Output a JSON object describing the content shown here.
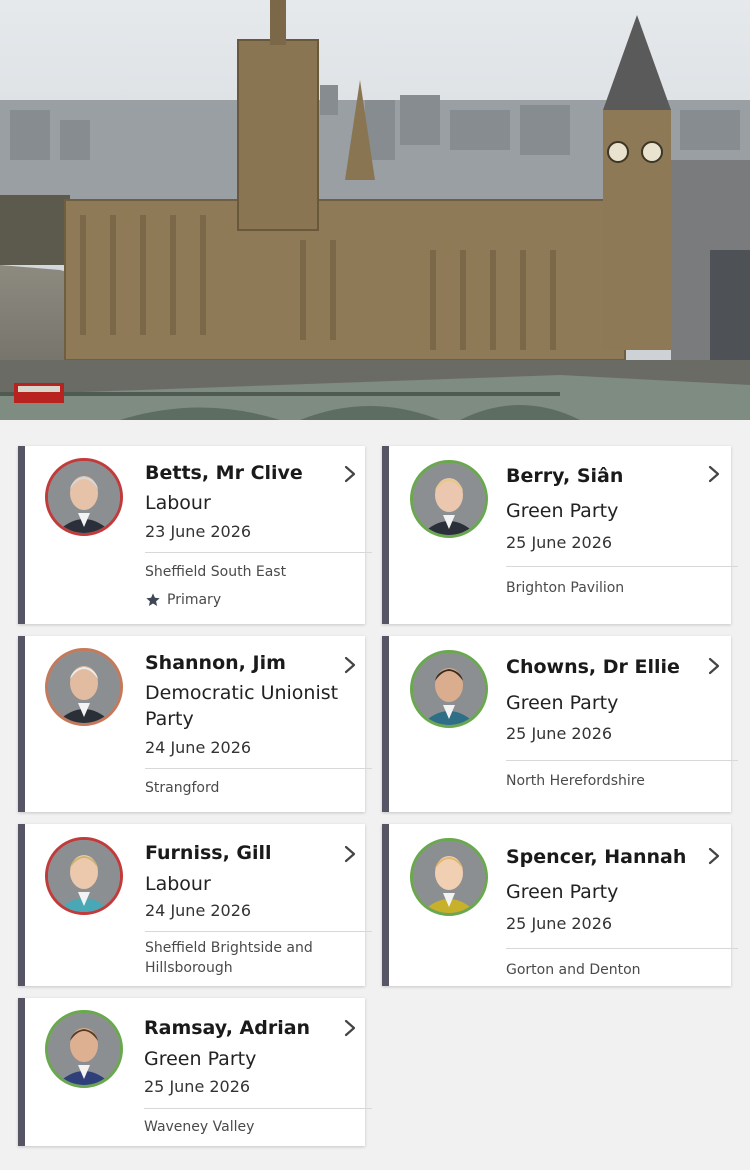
{
  "colors": {
    "card_bar": "#555566",
    "labour_ring": "#c23b3b",
    "dup_ring": "#c47a5a",
    "green_ring": "#6aa84f"
  },
  "hero": {
    "icon": "westminster-parliament-photo"
  },
  "members": [
    {
      "name": "Betts, Mr Clive",
      "party": "Labour",
      "date": "23 June 2026",
      "constituency": "Sheffield South East",
      "primary_label": "Primary",
      "ring": "labour"
    },
    {
      "name": "Berry, Siân",
      "party": "Green Party",
      "date": "25 June 2026",
      "constituency": "Brighton Pavilion",
      "ring": "green"
    },
    {
      "name": "Shannon, Jim",
      "party": "Democratic Unionist Party",
      "date": "24 June 2026",
      "constituency": "Strangford",
      "ring": "dup"
    },
    {
      "name": "Chowns, Dr Ellie",
      "party": "Green Party",
      "date": "25 June 2026",
      "constituency": "North Herefordshire",
      "ring": "green"
    },
    {
      "name": "Furniss, Gill",
      "party": "Labour",
      "date": "24 June 2026",
      "constituency": "Sheffield Brightside and Hillsborough",
      "ring": "labour"
    },
    {
      "name": "Spencer, Hannah",
      "party": "Green Party",
      "date": "25 June 2026",
      "constituency": "Gorton and Denton",
      "ring": "green"
    },
    {
      "name": "Ramsay, Adrian",
      "party": "Green Party",
      "date": "25 June 2026",
      "constituency": "Waveney Valley",
      "ring": "green"
    }
  ]
}
